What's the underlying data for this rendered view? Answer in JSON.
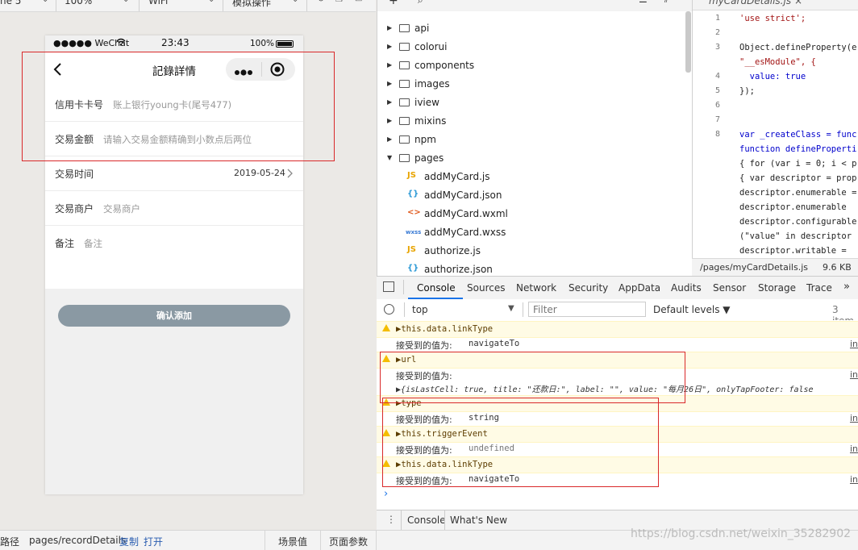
{
  "simulator_toolbar": {
    "device_select": "ne 5",
    "zoom_select": "100%",
    "network_select": "WiFi",
    "mode_select": "模拟操作"
  },
  "phone": {
    "status_bar": {
      "carrier": "●●●●● WeChat",
      "time": "23:43",
      "battery": "100%"
    },
    "nav_title": "記錄詳情",
    "rows": [
      {
        "label": "信用卡卡号",
        "value": "账上银行young卡(尾号477)"
      },
      {
        "label": "交易金额",
        "placeholder": "请输入交易金额精确到小数点后两位"
      },
      {
        "label": "交易时间",
        "value": "2019-05-24"
      },
      {
        "label": "交易商户",
        "placeholder": "交易商户"
      },
      {
        "label": "备注",
        "placeholder": "备注"
      }
    ],
    "submit_label": "确认添加"
  },
  "file_tree": {
    "items": [
      {
        "name": "api",
        "type": "folder",
        "expanded": false
      },
      {
        "name": "colorui",
        "type": "folder",
        "expanded": false
      },
      {
        "name": "components",
        "type": "folder",
        "expanded": false
      },
      {
        "name": "images",
        "type": "folder",
        "expanded": false
      },
      {
        "name": "iview",
        "type": "folder",
        "expanded": false
      },
      {
        "name": "mixins",
        "type": "folder",
        "expanded": false
      },
      {
        "name": "npm",
        "type": "folder",
        "expanded": false
      },
      {
        "name": "pages",
        "type": "folder",
        "expanded": true
      },
      {
        "name": "addMyCard.js",
        "type": "js",
        "icon_text": "JS"
      },
      {
        "name": "addMyCard.json",
        "type": "json",
        "icon_text": "{}"
      },
      {
        "name": "addMyCard.wxml",
        "type": "wxml",
        "icon_text": "<>"
      },
      {
        "name": "addMyCard.wxss",
        "type": "wxss",
        "icon_text": "wxss"
      },
      {
        "name": "authorize.js",
        "type": "js",
        "icon_text": "JS"
      },
      {
        "name": "authorize.json",
        "type": "json",
        "icon_text": "{}"
      }
    ]
  },
  "editor": {
    "tab_name": "myCardDetails.js",
    "tab_close": "×",
    "lines": [
      {
        "no": "1",
        "text": "'use strict';"
      },
      {
        "no": "2",
        "text": ""
      },
      {
        "no": "3",
        "text": "Object.defineProperty(e"
      },
      {
        "no": "",
        "text": "\"__esModule\", {"
      },
      {
        "no": "4",
        "text": "  value: true"
      },
      {
        "no": "5",
        "text": "});"
      },
      {
        "no": "6",
        "text": ""
      },
      {
        "no": "7",
        "text": ""
      },
      {
        "no": "8",
        "text": "var _createClass = func"
      },
      {
        "no": "",
        "text": "function defineProperti"
      },
      {
        "no": "",
        "text": "{ for (var i = 0; i < p"
      },
      {
        "no": "",
        "text": "{ var descriptor = prop"
      },
      {
        "no": "",
        "text": "descriptor.enumerable ="
      },
      {
        "no": "",
        "text": "descriptor.enumerable "
      },
      {
        "no": "",
        "text": "descriptor.configurable"
      },
      {
        "no": "",
        "text": "(\"value\" in descriptor"
      },
      {
        "no": "",
        "text": "descriptor.writable = "
      }
    ],
    "status_path": "/pages/myCardDetails.js",
    "status_size": "9.6 KB"
  },
  "devtools": {
    "tabs": [
      "Console",
      "Sources",
      "Network",
      "Security",
      "AppData",
      "Audits",
      "Sensor",
      "Storage",
      "Trace"
    ],
    "active_tab": "Console",
    "more": "»",
    "context_select": "top",
    "filter_placeholder": "Filter",
    "levels": "Default levels ▼",
    "count": "3 item"
  },
  "console": {
    "lines": [
      {
        "kind": "warn",
        "text": "▶this.data.linkType"
      },
      {
        "kind": "log",
        "label": "接受到的值为:",
        "value": "navigateTo",
        "link": "in"
      },
      {
        "kind": "warn",
        "text": "▶url"
      },
      {
        "kind": "log",
        "label": "接受到的值为:",
        "value": "",
        "link": "in"
      },
      {
        "kind": "obj",
        "text": "▶{isLastCell: true, title: \"还款日:\", label: \"\", value: \"每月26日\", onlyTapFooter: false"
      },
      {
        "kind": "warn",
        "text": "▶type"
      },
      {
        "kind": "log",
        "label": "接受到的值为:",
        "value": "string",
        "link": "in"
      },
      {
        "kind": "warn",
        "text": "▶this.triggerEvent"
      },
      {
        "kind": "log",
        "label": "接受到的值为:",
        "value": "undefined",
        "link": "in"
      },
      {
        "kind": "warn",
        "text": "▶this.data.linkType"
      },
      {
        "kind": "log",
        "label": "接受到的值为:",
        "value": "navigateTo",
        "link": "in"
      }
    ],
    "prompt": "›"
  },
  "drawer": {
    "tabs": [
      "Console",
      "What's New"
    ]
  },
  "bottom_bar": {
    "path_label": "路径",
    "path_value": "pages/recordDetails",
    "copy_label": "复制",
    "open_label": "打开",
    "scene_label": "场景值",
    "params_label": "页面参数"
  },
  "watermark": "https://blog.csdn.net/weixin_35282902"
}
